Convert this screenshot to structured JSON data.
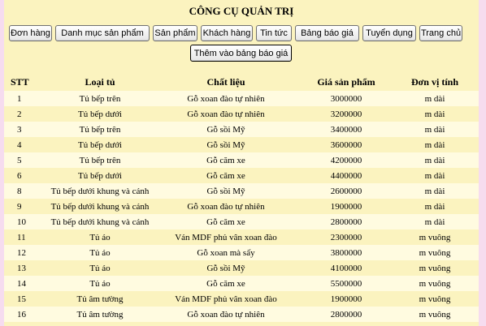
{
  "header": {
    "title": "CÔNG CỤ QUẢN TRỊ"
  },
  "menu": [
    {
      "label": "Đơn hàng"
    },
    {
      "label": "Danh mục sản phẩm"
    },
    {
      "label": "Sản phẩm"
    },
    {
      "label": "Khách hàng"
    },
    {
      "label": "Tin tức"
    },
    {
      "label": "Bảng báo giá"
    },
    {
      "label": "Tuyển dụng"
    },
    {
      "label": "Trang chủ"
    }
  ],
  "actions": {
    "add_label": "Thêm vào bảng báo giá"
  },
  "table": {
    "columns": [
      "STT",
      "Loại tủ",
      "Chất liệu",
      "Giá sản phẩm",
      "Đơn vị tính"
    ],
    "rows": [
      [
        "1",
        "Tủ bếp trên",
        "Gỗ xoan đào tự nhiên",
        "3000000",
        "m dài"
      ],
      [
        "2",
        "Tủ bếp dưới",
        "Gỗ xoan đào tự nhiên",
        "3200000",
        "m dài"
      ],
      [
        "3",
        "Tủ bếp trên",
        "Gỗ sồi Mỹ",
        "3400000",
        "m dài"
      ],
      [
        "4",
        "Tủ bếp dưới",
        "Gỗ sồi Mỹ",
        "3600000",
        "m dài"
      ],
      [
        "5",
        "Tủ bếp trên",
        "Gỗ căm xe",
        "4200000",
        "m dài"
      ],
      [
        "6",
        "Tủ bếp dưới",
        "Gỗ căm xe",
        "4400000",
        "m dài"
      ],
      [
        "8",
        "Tủ bếp dưới khung và cánh",
        "Gỗ sồi Mỹ",
        "2600000",
        "m dài"
      ],
      [
        "9",
        "Tủ bếp dưới khung và cánh",
        "Gỗ xoan đào tự nhiên",
        "1900000",
        "m dài"
      ],
      [
        "10",
        "Tủ bếp dưới khung và cánh",
        "Gỗ căm xe",
        "2800000",
        "m dài"
      ],
      [
        "11",
        "Tủ áo",
        "Ván MDF phủ vân xoan đào",
        "2300000",
        "m vuông"
      ],
      [
        "12",
        "Tủ áo",
        "Gỗ xoan mà sấy",
        "3800000",
        "m vuông"
      ],
      [
        "13",
        "Tủ áo",
        "Gỗ sồi Mỹ",
        "4100000",
        "m vuông"
      ],
      [
        "14",
        "Tủ áo",
        "Gỗ căm xe",
        "5500000",
        "m vuông"
      ],
      [
        "15",
        "Tủ âm tường",
        "Ván MDF phủ vân xoan đào",
        "1900000",
        "m vuông"
      ],
      [
        "16",
        "Tủ âm tường",
        "Gỗ xoan đào tự nhiên",
        "2800000",
        "m vuông"
      ]
    ]
  }
}
